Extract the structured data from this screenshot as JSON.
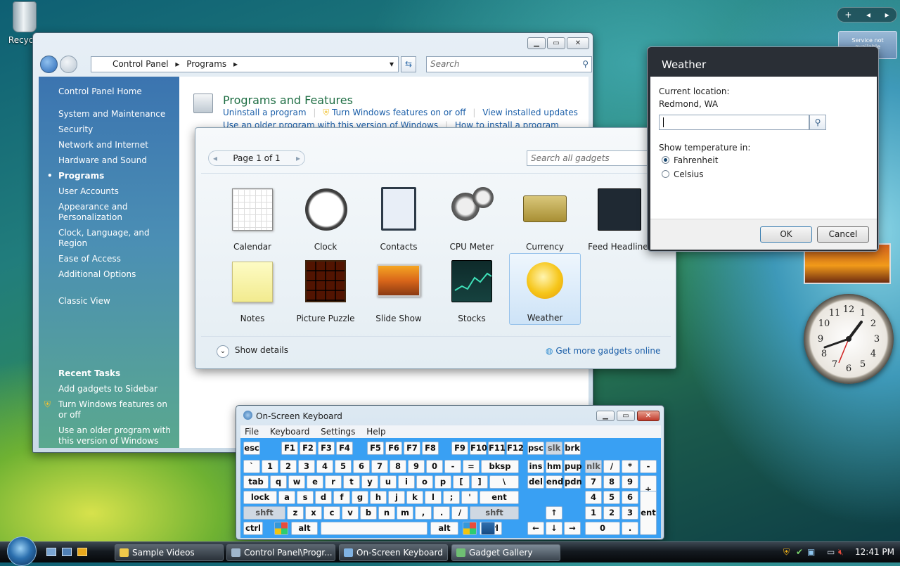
{
  "desktop": {
    "recycle_label": "Recycle"
  },
  "sidebar": {
    "add": "+",
    "prev": "◂",
    "next": "▸",
    "service_msg": "Service not available"
  },
  "control_panel": {
    "breadcrumb": [
      "Control Panel",
      "Programs"
    ],
    "search_placeholder": "Search",
    "left_items": [
      "Control Panel Home",
      "System and Maintenance",
      "Security",
      "Network and Internet",
      "Hardware and Sound",
      "Programs",
      "User Accounts",
      "Appearance and Personalization",
      "Clock, Language, and Region",
      "Ease of Access",
      "Additional Options",
      "Classic View"
    ],
    "recent_tasks_heading": "Recent Tasks",
    "recent_tasks": [
      "Add gadgets to Sidebar",
      "Turn Windows features on or off",
      "Use an older program with this version of Windows"
    ],
    "section_title": "Programs and Features",
    "section_links": [
      "Uninstall a program",
      "Turn Windows features on or off",
      "View installed updates"
    ],
    "section_links2": [
      "Use an older program with this version of Windows",
      "How to install a program"
    ]
  },
  "gadget_gallery": {
    "page": "Page 1 of 1",
    "search_placeholder": "Search all gadgets",
    "gadgets": [
      "Calendar",
      "Clock",
      "Contacts",
      "CPU Meter",
      "Currency",
      "Feed Headlines",
      "Notes",
      "Picture Puzzle",
      "Slide Show",
      "Stocks",
      "Weather"
    ],
    "show_details": "Show details",
    "get_more": "Get more gadgets online"
  },
  "weather": {
    "title": "Weather",
    "current_location_label": "Current location:",
    "current_location": "Redmond, WA",
    "location_input": "",
    "show_temp_label": "Show temperature in:",
    "units": [
      "Fahrenheit",
      "Celsius"
    ],
    "selected_unit": "Fahrenheit",
    "ok": "OK",
    "cancel": "Cancel"
  },
  "osk": {
    "title": "On-Screen Keyboard",
    "menu": [
      "File",
      "Keyboard",
      "Settings",
      "Help"
    ],
    "rows": [
      [
        "esc",
        "F1",
        "F2",
        "F3",
        "F4",
        "F5",
        "F6",
        "F7",
        "F8",
        "F9",
        "F10",
        "F11",
        "F12",
        "psc",
        "slk",
        "brk"
      ],
      [
        "`",
        "1",
        "2",
        "3",
        "4",
        "5",
        "6",
        "7",
        "8",
        "9",
        "0",
        "-",
        "=",
        "bksp",
        "ins",
        "hm",
        "pup",
        "nlk",
        "/",
        "*",
        "-"
      ],
      [
        "tab",
        "q",
        "w",
        "e",
        "r",
        "t",
        "y",
        "u",
        "i",
        "o",
        "p",
        "[",
        "]",
        "\\",
        "del",
        "end",
        "pdn",
        "7",
        "8",
        "9",
        "+"
      ],
      [
        "lock",
        "a",
        "s",
        "d",
        "f",
        "g",
        "h",
        "j",
        "k",
        "l",
        ";",
        "'",
        "ent",
        "4",
        "5",
        "6"
      ],
      [
        "shft",
        "z",
        "x",
        "c",
        "v",
        "b",
        "n",
        "m",
        ",",
        ".",
        "/",
        "shft",
        "↑",
        "1",
        "2",
        "3",
        "ent"
      ],
      [
        "ctrl",
        "alt",
        "alt",
        "ctrl",
        "←",
        "↓",
        "→",
        "0",
        "."
      ]
    ]
  },
  "taskbar": {
    "buttons": [
      "Sample Videos",
      "Control Panel\\Progr...",
      "On-Screen Keyboard",
      "Gadget Gallery"
    ],
    "time": "12:41 PM"
  },
  "colors": {
    "cp_left": "#3b74b0",
    "osk_keys_bg": "#39a0f3",
    "taskbar": "#141a20",
    "link": "#1a5ea8"
  }
}
